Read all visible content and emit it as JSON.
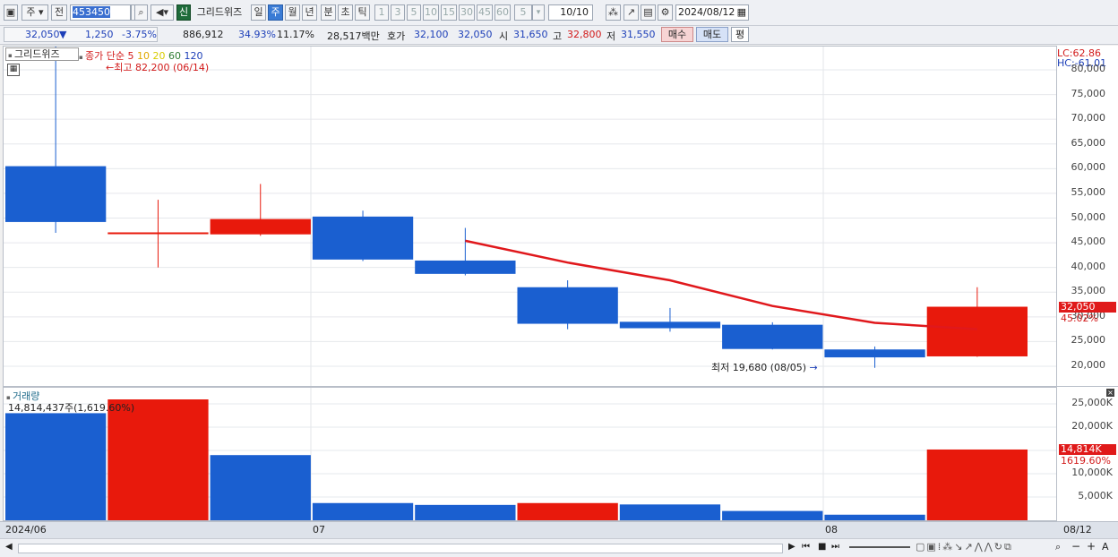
{
  "toolbar": {
    "market": "주",
    "prev": "전",
    "code": "453450",
    "new_tag": "신",
    "name": "그리드위즈",
    "periods": [
      "일",
      "주",
      "월",
      "년",
      "분",
      "초",
      "틱"
    ],
    "active_period": "주",
    "intervals": [
      "1",
      "3",
      "5",
      "10",
      "15",
      "30",
      "45",
      "60"
    ],
    "interval_value": "5",
    "count": "10/10",
    "date": "2024/08/12"
  },
  "info": {
    "price": "32,050",
    "arrow": "▼",
    "change": "1,250",
    "rate": "-3.75%",
    "volume": "886,912",
    "turnover": "34.93%",
    "ratio": "11.17%",
    "amount": "28,517백만",
    "ask_label": "호가",
    "ask1": "32,100",
    "ask2": "32,050",
    "open_label": "시",
    "open": "31,650",
    "high_label": "고",
    "high": "32,800",
    "low_label": "저",
    "low": "31,550",
    "buy": "매수",
    "sell": "매도",
    "eval": "평"
  },
  "price_panel": {
    "title": "그리드위즈",
    "legend_label": "종가 단순",
    "ma_periods": [
      {
        "label": "5",
        "color": "#d21a1a"
      },
      {
        "label": "10",
        "color": "#e0a800"
      },
      {
        "label": "20",
        "color": "#d8cc00"
      },
      {
        "label": "60",
        "color": "#2e7d32"
      },
      {
        "label": "120",
        "color": "#1d3fb8"
      }
    ],
    "high_annot": "최고 82,200 (06/14)",
    "low_annot": "최저 19,680 (08/05)",
    "lc": "LC:62.86",
    "hc": "HC:-61.01",
    "current_tag": "32,050",
    "current_pct": "45.02%"
  },
  "volume_panel": {
    "title": "거래량",
    "value_text": "14,814,437주(1,619.60%)",
    "current_tag": "14,814K",
    "current_pct": "1619.60%"
  },
  "x_labels": [
    "2024/06",
    "07",
    "08",
    "08/12"
  ],
  "colors": {
    "up": "#e8190c",
    "down": "#1a5fd0",
    "ma5": "#e0181c"
  },
  "chart_data": [
    {
      "type": "candlestick",
      "title": "그리드위즈",
      "ylim": [
        20000,
        82200
      ],
      "y_ticks": [
        20000,
        25000,
        30000,
        35000,
        40000,
        45000,
        50000,
        55000,
        60000,
        65000,
        70000,
        75000,
        80000
      ],
      "y_tick_labels": [
        "20,000",
        "25,000",
        "30,000",
        "35,000",
        "40,000",
        "45,000",
        "50,000",
        "55,000",
        "60,000",
        "65,000",
        "70,000",
        "75,000",
        "80,000"
      ],
      "candles": [
        {
          "open": 60500,
          "high": 82200,
          "low": 47000,
          "close": 49200
        },
        {
          "open": 46800,
          "high": 53700,
          "low": 40000,
          "close": 47100
        },
        {
          "open": 46700,
          "high": 56900,
          "low": 46400,
          "close": 49800
        },
        {
          "open": 50300,
          "high": 51500,
          "low": 41300,
          "close": 41600
        },
        {
          "open": 41400,
          "high": 48000,
          "low": 38400,
          "close": 38700
        },
        {
          "open": 36000,
          "high": 37400,
          "low": 27500,
          "close": 28600
        },
        {
          "open": 29000,
          "high": 31800,
          "low": 27000,
          "close": 27700
        },
        {
          "open": 28400,
          "high": 28900,
          "low": 23400,
          "close": 23500
        },
        {
          "open": 23400,
          "high": 24000,
          "low": 19680,
          "close": 21800
        },
        {
          "open": 22000,
          "high": 36000,
          "low": 21900,
          "close": 32050
        }
      ],
      "ma5": [
        null,
        null,
        null,
        null,
        45400,
        41000,
        37400,
        32200,
        28800,
        27500
      ]
    },
    {
      "type": "bar",
      "title": "거래량",
      "ylim": [
        0,
        26000
      ],
      "y_ticks": [
        5000,
        10000,
        15000,
        20000,
        25000
      ],
      "y_tick_labels": [
        "5,000K",
        "10,000K",
        "15,000K",
        "20,000K",
        "25,000K"
      ],
      "values": [
        23000,
        26200,
        14000,
        3700,
        3300,
        3700,
        3400,
        2000,
        1200,
        15200
      ],
      "directions": [
        "down",
        "up",
        "down",
        "down",
        "down",
        "up",
        "down",
        "down",
        "down",
        "up"
      ]
    }
  ]
}
